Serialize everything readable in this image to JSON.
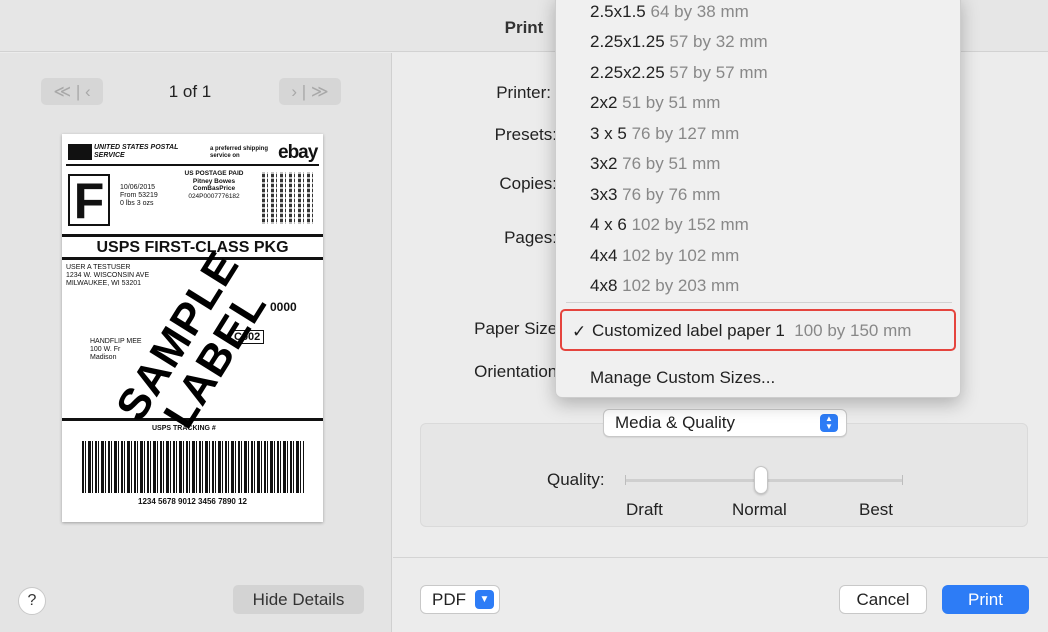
{
  "window": {
    "title": "Print"
  },
  "preview": {
    "page_count": "1 of 1",
    "first_glyph": "≪ | ‹",
    "last_glyph": "› | ≫",
    "label": {
      "carrier": "UNITED STATES POSTAL SERVICE",
      "preferred": "a preferred shipping service on",
      "ebay": "ebay",
      "class_letter": "F",
      "date": "10/06/2015",
      "from_zip": "From 53219",
      "weight": "0 lbs 3 ozs",
      "postage_paid": "US POSTAGE PAID",
      "vendor": "Pitney Bowes",
      "price": "ComBasPrice",
      "meter": "024P0007776182",
      "service": "USPS FIRST-CLASS PKG",
      "from_name": "USER A TESTUSER",
      "from_street": "1234 W. WISCONSIN AVE",
      "from_city": "MILWAUKEE, WI 53201",
      "code": "0000",
      "route": "C002",
      "to_name": "HANDFLIP MEE",
      "to_street": "100 W. Fr",
      "to_city": "Madison",
      "tracking_label": "USPS TRACKING #",
      "tracking_number": "1234 5678 9012 3456 7890 12",
      "watermark": "SAMPLE LABEL"
    },
    "help": "?",
    "hide_details": "Hide Details"
  },
  "settings": {
    "printer_label": "Printer:",
    "presets_label": "Presets:",
    "copies_label": "Copies:",
    "pages_label": "Pages:",
    "paper_size_label": "Paper Size:",
    "orientation_label": "Orientation:",
    "section_select": "Media & Quality",
    "quality_label": "Quality:",
    "quality_levels": [
      "Draft",
      "Normal",
      "Best"
    ],
    "quality_value": "Normal"
  },
  "footer": {
    "pdf": "PDF",
    "cancel": "Cancel",
    "print": "Print"
  },
  "paper_menu": {
    "items": [
      {
        "name": "2.5x1.5",
        "size": "64 by 38 mm"
      },
      {
        "name": "2.25x1.25",
        "size": "57 by 32 mm"
      },
      {
        "name": "2.25x2.25",
        "size": "57 by 57 mm"
      },
      {
        "name": "2x2",
        "size": "51 by 51 mm"
      },
      {
        "name": "3 x 5",
        "size": "76 by 127 mm"
      },
      {
        "name": "3x2",
        "size": "76 by 51 mm"
      },
      {
        "name": "3x3",
        "size": "76 by 76 mm"
      },
      {
        "name": "4 x 6",
        "size": "102 by 152 mm"
      },
      {
        "name": "4x4",
        "size": "102 by 102 mm"
      },
      {
        "name": "4x8",
        "size": "102 by 203 mm"
      }
    ],
    "selected": {
      "check": "✓",
      "name": "Customized label paper 1",
      "size": "100 by 150 mm"
    },
    "manage": "Manage Custom Sizes..."
  },
  "colors": {
    "accent": "#2d7cf6",
    "highlight_border": "#e5443d"
  }
}
